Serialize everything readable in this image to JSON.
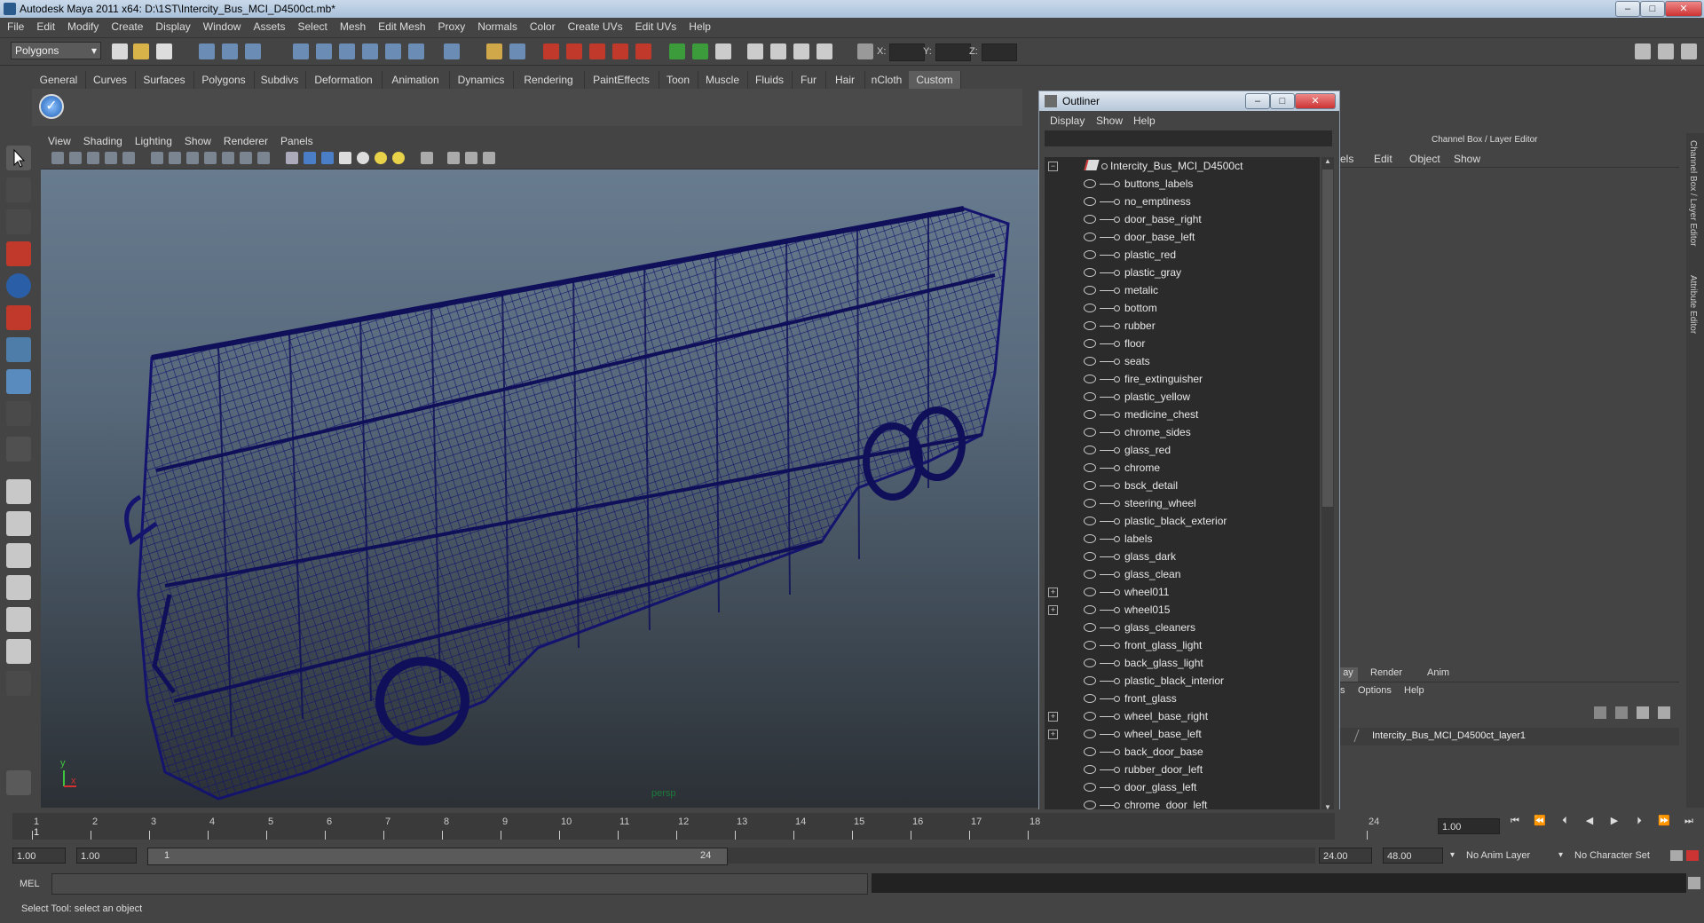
{
  "window": {
    "title": "Autodesk Maya 2011 x64: D:\\1ST\\Intercity_Bus_MCI_D4500ct.mb*"
  },
  "menubar": [
    "File",
    "Edit",
    "Modify",
    "Create",
    "Display",
    "Window",
    "Assets",
    "Select",
    "Mesh",
    "Edit Mesh",
    "Proxy",
    "Normals",
    "Color",
    "Create UVs",
    "Edit UVs",
    "Help"
  ],
  "statusline": {
    "mode": "Polygons",
    "x_label": "X:",
    "y_label": "Y:",
    "z_label": "Z:"
  },
  "shelf_tabs": [
    "General",
    "Curves",
    "Surfaces",
    "Polygons",
    "Subdivs",
    "Deformation",
    "Animation",
    "Dynamics",
    "Rendering",
    "PaintEffects",
    "Toon",
    "Muscle",
    "Fluids",
    "Fur",
    "Hair",
    "nCloth",
    "Custom"
  ],
  "shelf_active": "Custom",
  "viewport": {
    "menu": [
      "View",
      "Shading",
      "Lighting",
      "Show",
      "Renderer",
      "Panels"
    ],
    "camera_label": "persp",
    "axis_y": "y",
    "axis_x": "x",
    "wire_color": "#14146e"
  },
  "outliner": {
    "title": "Outliner",
    "menu": [
      "Display",
      "Show",
      "Help"
    ],
    "root": "Intercity_Bus_MCI_D4500ct",
    "items": [
      {
        "label": "buttons_labels",
        "expandable": false
      },
      {
        "label": "no_emptiness",
        "expandable": false
      },
      {
        "label": "door_base_right",
        "expandable": false
      },
      {
        "label": "door_base_left",
        "expandable": false
      },
      {
        "label": "plastic_red",
        "expandable": false
      },
      {
        "label": "plastic_gray",
        "expandable": false
      },
      {
        "label": "metalic",
        "expandable": false
      },
      {
        "label": "bottom",
        "expandable": false
      },
      {
        "label": "rubber",
        "expandable": false
      },
      {
        "label": "floor",
        "expandable": false
      },
      {
        "label": "seats",
        "expandable": false
      },
      {
        "label": "fire_extinguisher",
        "expandable": false
      },
      {
        "label": "plastic_yellow",
        "expandable": false
      },
      {
        "label": "medicine_chest",
        "expandable": false
      },
      {
        "label": "chrome_sides",
        "expandable": false
      },
      {
        "label": "glass_red",
        "expandable": false
      },
      {
        "label": "chrome",
        "expandable": false
      },
      {
        "label": "bsck_detail",
        "expandable": false
      },
      {
        "label": "steering_wheel",
        "expandable": false
      },
      {
        "label": "plastic_black_exterior",
        "expandable": false
      },
      {
        "label": "labels",
        "expandable": false
      },
      {
        "label": "glass_dark",
        "expandable": false
      },
      {
        "label": "glass_clean",
        "expandable": false
      },
      {
        "label": "wheel011",
        "expandable": true
      },
      {
        "label": "wheel015",
        "expandable": true
      },
      {
        "label": "glass_cleaners",
        "expandable": false
      },
      {
        "label": "front_glass_light",
        "expandable": false
      },
      {
        "label": "back_glass_light",
        "expandable": false
      },
      {
        "label": "plastic_black_interior",
        "expandable": false
      },
      {
        "label": "front_glass",
        "expandable": false
      },
      {
        "label": "wheel_base_right",
        "expandable": true
      },
      {
        "label": "wheel_base_left",
        "expandable": true
      },
      {
        "label": "back_door_base",
        "expandable": false
      },
      {
        "label": "rubber_door_left",
        "expandable": false
      },
      {
        "label": "door_glass_left",
        "expandable": false
      },
      {
        "label": "chrome_door_left",
        "expandable": false
      }
    ]
  },
  "channelbox": {
    "title": "Channel Box / Layer Editor",
    "menu": [
      "els",
      "Edit",
      "Object",
      "Show"
    ],
    "layer_tabs": [
      "ay",
      "Render",
      "Anim"
    ],
    "layer_menu": [
      "s",
      "Options",
      "Help"
    ],
    "layer_name": "Intercity_Bus_MCI_D4500ct_layer1",
    "side_tabs": [
      "Channel Box / Layer Editor",
      "Attribute Editor"
    ]
  },
  "timeline": {
    "ticks": [
      "1",
      "2",
      "3",
      "4",
      "5",
      "6",
      "7",
      "8",
      "9",
      "10",
      "11",
      "12",
      "13",
      "14",
      "15",
      "16",
      "17",
      "18",
      "24"
    ],
    "current_frame": "1",
    "current_time": "1.00"
  },
  "range": {
    "start": "1.00",
    "playback_start": "1.00",
    "slider_start": "1",
    "slider_end": "24",
    "playback_end": "24.00",
    "end": "48.00",
    "anim_layer": "No Anim Layer",
    "char_set": "No Character Set"
  },
  "cmdline": {
    "label": "MEL"
  },
  "helpline": {
    "text": "Select Tool: select an object"
  }
}
